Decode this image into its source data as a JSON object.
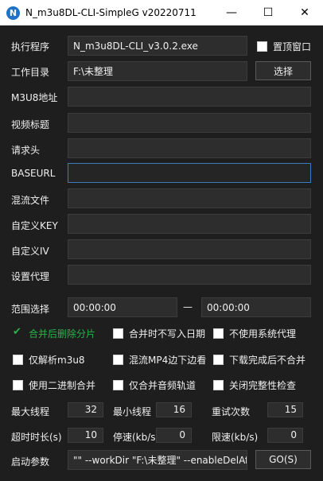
{
  "window": {
    "title": "N_m3u8DL-CLI-SimpleG v20220711",
    "icon_letter": "N",
    "minimize": "—",
    "maximize": "☐",
    "close": "✕"
  },
  "form": {
    "exe": {
      "label": "执行程序",
      "value": "N_m3u8DL-CLI_v3.0.2.exe"
    },
    "topmost": {
      "label": "置顶窗口",
      "checked": false
    },
    "workdir": {
      "label": "工作目录",
      "value": "F:\\未整理",
      "button": "选择"
    },
    "m3u8": {
      "label": "M3U8地址",
      "value": ""
    },
    "video_title": {
      "label": "视频标题",
      "value": ""
    },
    "headers": {
      "label": "请求头",
      "value": ""
    },
    "baseurl": {
      "label": "BASEURL",
      "value": ""
    },
    "mux_file": {
      "label": "混流文件",
      "value": ""
    },
    "custom_key": {
      "label": "自定义KEY",
      "value": ""
    },
    "custom_iv": {
      "label": "自定义IV",
      "value": ""
    },
    "proxy": {
      "label": "设置代理",
      "value": ""
    },
    "range": {
      "label": "范围选择",
      "start": "00:00:00",
      "separator": "—",
      "end": "00:00:00"
    }
  },
  "options": [
    {
      "label": "合并后删除分片",
      "checked": true
    },
    {
      "label": "合并时不写入日期",
      "checked": false
    },
    {
      "label": "不使用系统代理",
      "checked": false
    },
    {
      "label": "仅解析m3u8",
      "checked": false
    },
    {
      "label": "混流MP4边下边看",
      "checked": false
    },
    {
      "label": "下载完成后不合并",
      "checked": false
    },
    {
      "label": "使用二进制合并",
      "checked": false
    },
    {
      "label": "仅合并音频轨道",
      "checked": false
    },
    {
      "label": "关闭完整性检查",
      "checked": false
    }
  ],
  "numbers": {
    "max_threads": {
      "label": "最大线程",
      "value": "32"
    },
    "min_threads": {
      "label": "最小线程",
      "value": "16"
    },
    "retry": {
      "label": "重试次数",
      "value": "15"
    },
    "timeout": {
      "label": "超时时长(s)",
      "value": "10"
    },
    "stop_speed": {
      "label": "停速(kb/s)",
      "value": "0"
    },
    "limit_speed": {
      "label": "限速(kb/s)",
      "value": "0"
    }
  },
  "launch": {
    "label": "启动参数",
    "value": "\"\" --workDir \"F:\\未整理\" --enableDelAf",
    "button": "GO(S)"
  },
  "colors": {
    "accent_green": "#26b34a",
    "focus_blue": "#3d7dbf",
    "background": "#1e1e1e"
  }
}
